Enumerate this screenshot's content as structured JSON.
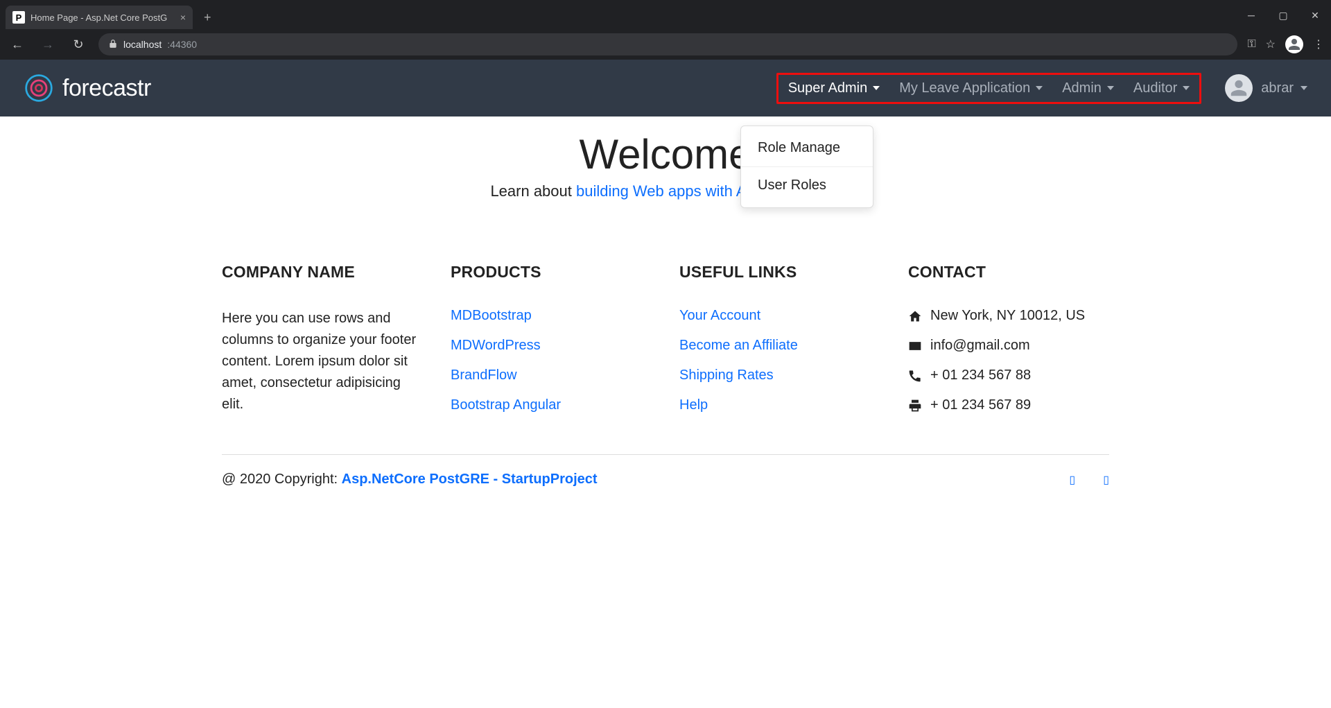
{
  "browser": {
    "tab_title": "Home Page - Asp.Net Core PostG",
    "favicon_letter": "P",
    "url_host": "localhost",
    "url_port": ":44360",
    "tab_close": "×",
    "new_tab": "+",
    "window_min": "─",
    "window_max": "▢",
    "window_close": "✕",
    "nav_back": "←",
    "nav_forward": "→",
    "nav_reload": "↻",
    "key_icon": "⚿",
    "star_icon": "☆",
    "more_icon": "⋮"
  },
  "navbar": {
    "brand": "forecastr",
    "items": [
      {
        "label": "Super Admin",
        "active": true
      },
      {
        "label": "My Leave Application",
        "active": false
      },
      {
        "label": "Admin",
        "active": false
      },
      {
        "label": "Auditor",
        "active": false
      }
    ],
    "user": "abrar"
  },
  "dropdown": {
    "items": [
      "Role Manage",
      "User Roles"
    ]
  },
  "hero": {
    "title": "Welcome",
    "learn_prefix": "Learn about ",
    "learn_link": "building Web apps with ASP.NET Core",
    "trailing_dot": "."
  },
  "footer": {
    "company": {
      "heading": "COMPANY NAME",
      "desc": "Here you can use rows and columns to organize your footer content. Lorem ipsum dolor sit amet, consectetur adipisicing elit."
    },
    "products": {
      "heading": "PRODUCTS",
      "links": [
        "MDBootstrap",
        "MDWordPress",
        "BrandFlow",
        "Bootstrap Angular"
      ]
    },
    "useful": {
      "heading": "USEFUL LINKS",
      "links": [
        "Your Account",
        "Become an Affiliate",
        "Shipping Rates",
        "Help"
      ]
    },
    "contact": {
      "heading": "CONTACT",
      "address": "New York, NY 10012, US",
      "email": "info@gmail.com",
      "phone": "+ 01 234 567 88",
      "fax": "+ 01 234 567 89"
    },
    "copyright_prefix": "@ 2020 Copyright: ",
    "copyright_link": "Asp.NetCore PostGRE - StartupProject",
    "social_icon_placeholder": "▯"
  }
}
